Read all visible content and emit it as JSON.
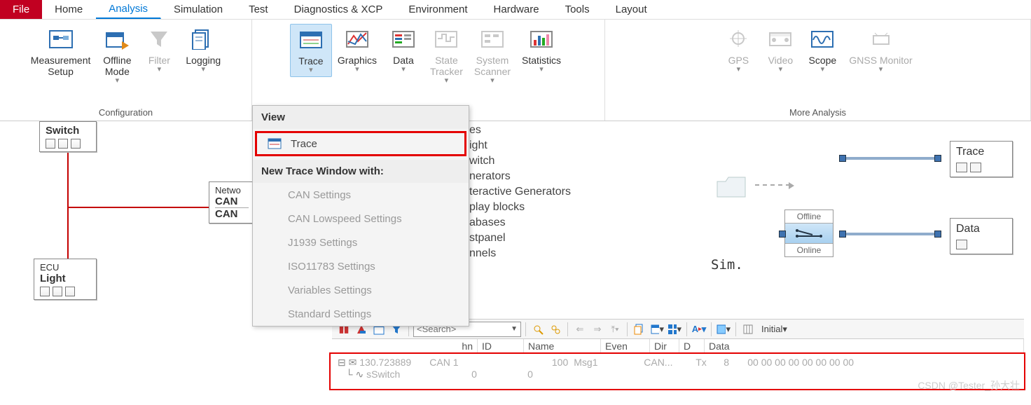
{
  "menu": {
    "file": "File",
    "tabs": [
      "Home",
      "Analysis",
      "Simulation",
      "Test",
      "Diagnostics & XCP",
      "Environment",
      "Hardware",
      "Tools",
      "Layout"
    ],
    "active_index": 1
  },
  "ribbon": {
    "group1_label": "Configuration",
    "group3_label": "More Analysis",
    "items": {
      "meas_setup": "Measurement\nSetup",
      "offline_mode": "Offline\nMode",
      "filter": "Filter",
      "logging": "Logging",
      "trace": "Trace",
      "graphics": "Graphics",
      "data": "Data",
      "state_tracker": "State\nTracker",
      "system_scanner": "System\nScanner",
      "statistics": "Statistics",
      "gps": "GPS",
      "video": "Video",
      "scope": "Scope",
      "gnss": "GNSS Monitor"
    }
  },
  "dropdown": {
    "view_header": "View",
    "trace_item": "Trace",
    "new_window_header": "New Trace Window with:",
    "items": [
      "CAN Settings",
      "CAN Lowspeed Settings",
      "J1939 Settings",
      "ISO11783 Settings",
      "Variables Settings",
      "Standard Settings"
    ]
  },
  "nodes": {
    "switch": {
      "title": "Switch"
    },
    "network": {
      "line1": "Netwo",
      "line2": "CAN",
      "line3": "CAN"
    },
    "ecu": {
      "line1": "ECU",
      "line2": "Light"
    }
  },
  "tree_fragments": [
    "es",
    "ight",
    "witch",
    "nerators",
    "teractive Generators",
    "play blocks",
    "abases",
    "stpanel",
    "nnels"
  ],
  "sim_label": "Sim.",
  "mode_box": {
    "offline": "Offline",
    "online": "Online"
  },
  "right_nodes": {
    "trace": "Trace",
    "data": "Data"
  },
  "toolbar": {
    "search_placeholder": "<Search>",
    "initial_label": "Initial"
  },
  "grid": {
    "headers": [
      "hn",
      "ID",
      "Name",
      "Even",
      "Dir",
      "D",
      "Data"
    ],
    "row1": {
      "time": "130.723889",
      "chn": "CAN 1",
      "id": "100",
      "name": "Msg1",
      "event": "CAN...",
      "dir": "Tx",
      "dlc": "8",
      "data": "00 00 00 00 00 00 00 00"
    },
    "row2": {
      "sig": "sSwitch",
      "v1": "0",
      "v2": "0"
    }
  },
  "watermark": "CSDN @Tester_孙大壮"
}
